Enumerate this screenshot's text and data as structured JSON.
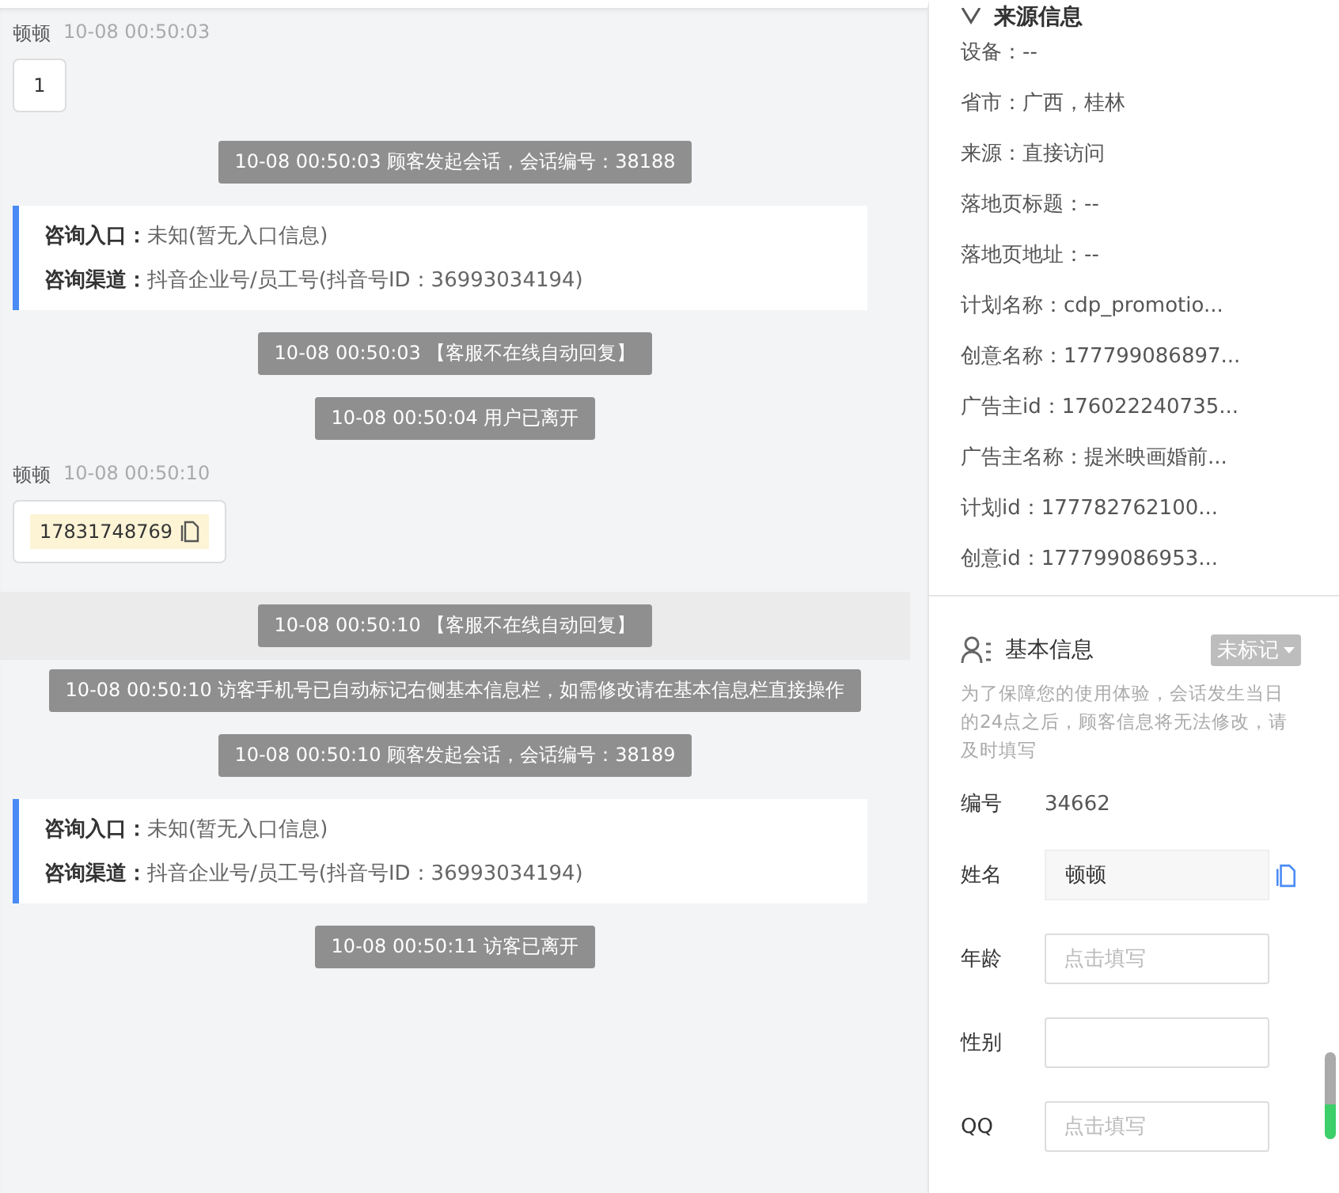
{
  "chat": {
    "messages": [
      {
        "kind": "message",
        "sender": "顿顿",
        "time": "10-08 00:50:03",
        "content": "1",
        "phone": false
      },
      {
        "kind": "system",
        "text": "10-08 00:50:03 顾客发起会话，会话编号：38188",
        "highlighted": false
      },
      {
        "kind": "info",
        "rows": [
          {
            "label": "咨询入口：",
            "value": "未知(暂无入口信息)"
          },
          {
            "label": "咨询渠道：",
            "value": "抖音企业号/员工号(抖音号ID：36993034194)"
          }
        ]
      },
      {
        "kind": "system",
        "text": "10-08 00:50:03 【客服不在线自动回复】",
        "highlighted": false
      },
      {
        "kind": "system",
        "text": "10-08 00:50:04 用户已离开",
        "highlighted": false
      },
      {
        "kind": "message",
        "sender": "顿顿",
        "time": "10-08 00:50:10",
        "content": "17831748769",
        "phone": true
      },
      {
        "kind": "system",
        "text": "10-08 00:50:10 【客服不在线自动回复】",
        "highlighted": true
      },
      {
        "kind": "system",
        "text": "10-08 00:50:10 访客手机号已自动标记右侧基本信息栏，如需修改请在基本信息栏直接操作",
        "highlighted": false
      },
      {
        "kind": "system",
        "text": "10-08 00:50:10 顾客发起会话，会话编号：38189",
        "highlighted": false
      },
      {
        "kind": "info",
        "rows": [
          {
            "label": "咨询入口：",
            "value": "未知(暂无入口信息)"
          },
          {
            "label": "咨询渠道：",
            "value": "抖音企业号/员工号(抖音号ID：36993034194)"
          }
        ]
      },
      {
        "kind": "system",
        "text": "10-08 00:50:11 访客已离开",
        "highlighted": false
      }
    ]
  },
  "source_info": {
    "title": "来源信息",
    "items": [
      "设备：--",
      "省市：广西，桂林",
      "来源：直接访问",
      "落地页标题：--",
      "落地页地址：--",
      "计划名称：cdp_promotio...",
      "创意名称：177799086897...",
      "广告主id：176022240735...",
      "广告主名称：提米映画婚前...",
      "计划id：177782762100...",
      "创意id：177799086953..."
    ]
  },
  "basic_info": {
    "title": "基本信息",
    "tag": "未标记",
    "notice": "为了保障您的使用体验，会话发生当日的24点之后，顾客信息将无法修改，请及时填写",
    "fields": [
      {
        "kind": "text",
        "label": "编号",
        "value": "34662"
      },
      {
        "kind": "readonly",
        "label": "姓名",
        "value": "顿顿"
      },
      {
        "kind": "input",
        "label": "年龄",
        "placeholder": "点击填写"
      },
      {
        "kind": "input",
        "label": "性别"
      },
      {
        "kind": "input",
        "label": "QQ",
        "placeholder": "点击填写"
      }
    ]
  }
}
